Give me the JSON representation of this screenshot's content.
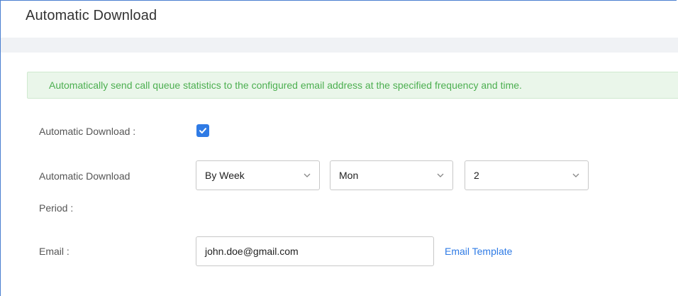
{
  "header": {
    "title": "Automatic Download"
  },
  "notice": {
    "text": "Automatically send call queue statistics to the configured email address at the specified frequency and time."
  },
  "form": {
    "auto_download": {
      "label": "Automatic Download :",
      "checked": true
    },
    "period": {
      "label_line1": "Automatic Download",
      "label_line2": "Period :",
      "frequency": "By Week",
      "day": "Mon",
      "hour": "2"
    },
    "email": {
      "label": "Email :",
      "value": "john.doe@gmail.com",
      "template_link": "Email Template"
    }
  },
  "icons": {
    "checkbox": "check-icon",
    "dropdown": "chevron-down-icon"
  },
  "colors": {
    "accent": "#2f7be5",
    "notice_text": "#4caf50",
    "notice_bg": "#eaf6ea"
  }
}
